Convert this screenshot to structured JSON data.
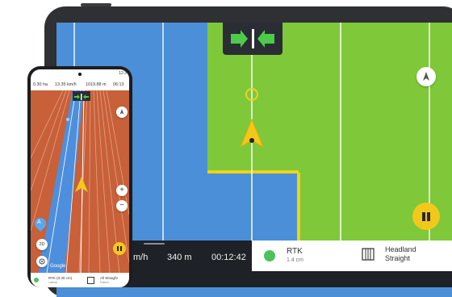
{
  "tablet": {
    "bottom": {
      "speed_partial": "m/h",
      "distance": "340 m",
      "time": "00:12:42",
      "rtk_label": "RTK",
      "rtk_value": "1.4 cm",
      "headland_line1": "Headland",
      "headland_line2": "Straight"
    },
    "icons": {
      "direction": "arrows-inward-icon",
      "compass": "compass-icon",
      "pause": "pause-icon",
      "headland": "headland-icon"
    },
    "colors": {
      "field_blue": "#4a8fd8",
      "field_green": "#7ec83a",
      "accent_yellow": "#f2c81b",
      "rtk_green": "#4cc35a"
    }
  },
  "phone": {
    "status": {
      "time": "12:3"
    },
    "info": {
      "area": "0.30 ha",
      "speed": "13.35 km/h",
      "distance": "1019.88 m",
      "time": "06:13"
    },
    "map_attribution": "Google",
    "a_marker": "A",
    "view_button": "2D",
    "bottom": {
      "rtk": "RTK (0.30 cm)",
      "rtk_sub": "Lateral",
      "mode": "All Straight",
      "mode_sub": "Pattern"
    }
  }
}
